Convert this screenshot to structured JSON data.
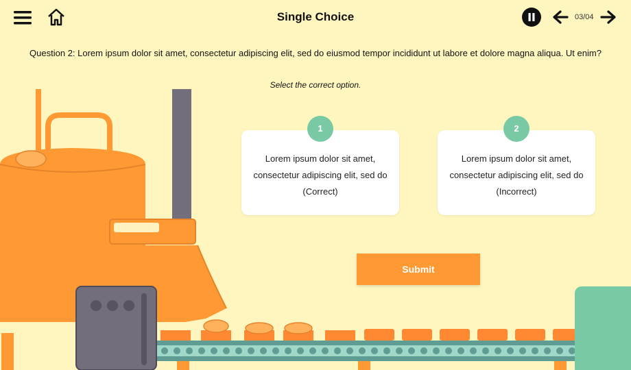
{
  "header": {
    "title": "Single Choice",
    "counter": "03/04"
  },
  "question": "Question 2: Lorem ipsum dolor sit amet, consectetur adipiscing elit, sed do eiusmod tempor incididunt ut labore et dolore magna aliqua. Ut enim?",
  "instruction": "Select the correct option.",
  "options": [
    {
      "number": "1",
      "text": "Lorem ipsum dolor sit amet, consectetur adipiscing elit, sed do (Correct)"
    },
    {
      "number": "2",
      "text": "Lorem ipsum dolor sit amet, consectetur adipiscing elit, sed do (Incorrect)"
    }
  ],
  "submit_label": "Submit",
  "colors": {
    "background": "#FFF6BF",
    "accent": "#FF9933",
    "badge": "#79C9A5",
    "machine_gray": "#726E7C"
  },
  "icons": {
    "menu": "menu-icon",
    "home": "home-icon",
    "pause": "pause-icon",
    "prev": "arrow-left-icon",
    "next": "arrow-right-icon"
  }
}
